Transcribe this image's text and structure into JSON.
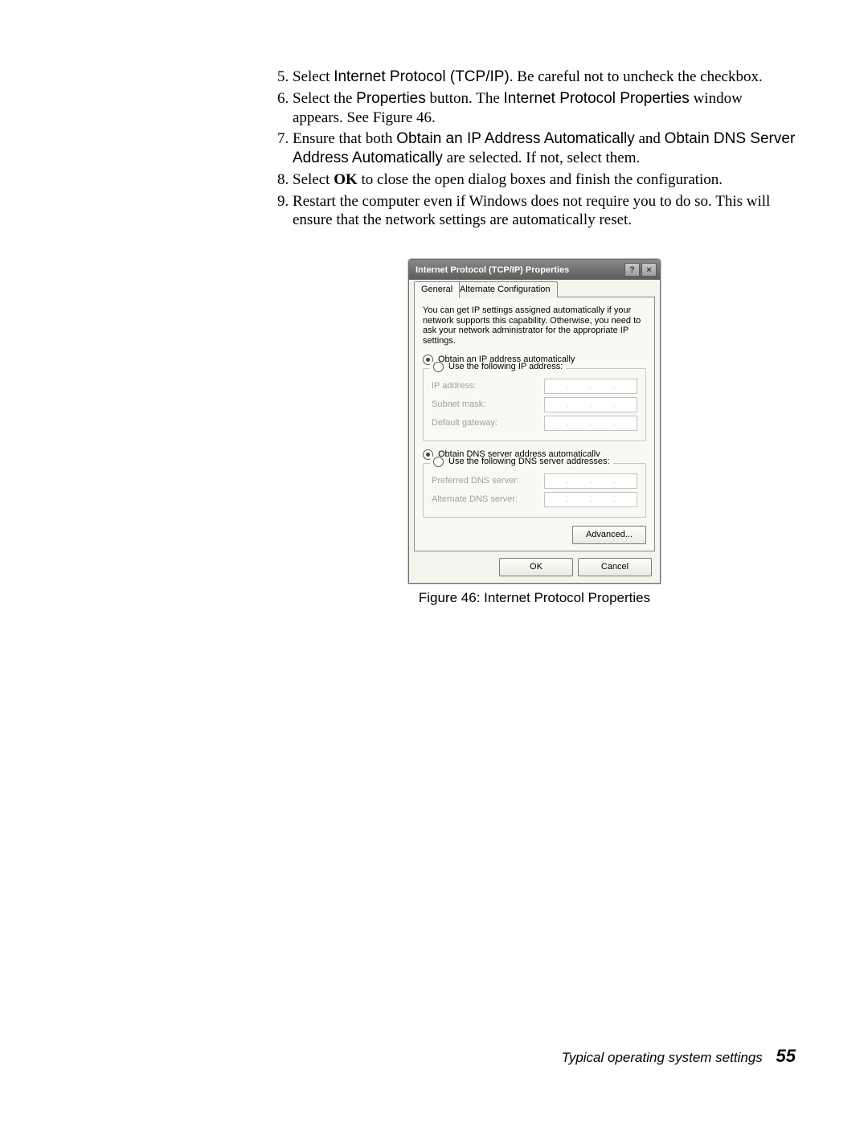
{
  "steps": {
    "start": 5,
    "items": [
      {
        "pre": "Select ",
        "sans": "Internet Protocol (TCP/IP)",
        "post": ". Be careful not to uncheck the checkbox."
      },
      {
        "pre": "Select the ",
        "sans": "Properties",
        "mid": " button. The ",
        "sans2": "Internet Protocol Properties",
        "post": " window appears. See Figure 46."
      },
      {
        "pre": "Ensure that both ",
        "sans": "Obtain an IP Address Automatically",
        "mid": " and ",
        "sans2": "Obtain DNS Server Address Automatically",
        "post": " are selected. If not, select them."
      },
      {
        "pre": "Select ",
        "bold": "OK",
        "post": " to close the open dialog boxes and finish the configuration."
      },
      {
        "pre": "Restart the computer even if Windows does not require you to do so. This will ensure that the network settings are automatically reset.",
        "sans": "",
        "post": ""
      }
    ]
  },
  "dialog": {
    "title": "Internet Protocol (TCP/IP) Properties",
    "tabs": {
      "active": "General",
      "other": "Alternate Configuration"
    },
    "description": "You can get IP settings assigned automatically if your network supports this capability. Otherwise, you need to ask your network administrator for the appropriate IP settings.",
    "ip": {
      "auto": "Obtain an IP address automatically",
      "manual": "Use the following IP address:",
      "fields": {
        "addr": "IP address:",
        "mask": "Subnet mask:",
        "gw": "Default gateway:"
      }
    },
    "dns": {
      "auto": "Obtain DNS server address automatically",
      "manual": "Use the following DNS server addresses:",
      "fields": {
        "pref": "Preferred DNS server:",
        "alt": "Alternate DNS server:"
      }
    },
    "buttons": {
      "advanced": "Advanced...",
      "ok": "OK",
      "cancel": "Cancel"
    }
  },
  "caption": "Figure 46:  Internet Protocol Properties",
  "footer": {
    "text": "Typical operating system settings",
    "page": "55"
  }
}
